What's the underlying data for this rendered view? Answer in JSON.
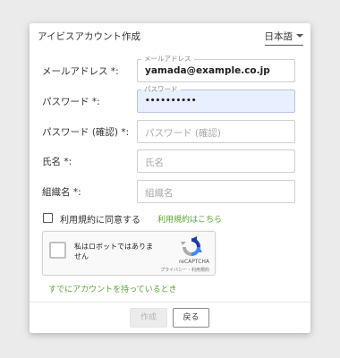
{
  "dialog": {
    "title": "アイビスアカウント作成",
    "language": "日本語"
  },
  "form": {
    "email": {
      "label": "メールアドレス *:",
      "legend": "メールアドレス",
      "value": "yamada@example.co.jp"
    },
    "password": {
      "label": "パスワード *:",
      "legend": "パスワード",
      "value": "••••••••••"
    },
    "password_confirm": {
      "label": "パスワード (確認) *:",
      "placeholder": "パスワード (確認)"
    },
    "name": {
      "label": "氏名 *:",
      "placeholder": "氏名"
    },
    "organization": {
      "label": "組織名 *:",
      "placeholder": "組織名"
    },
    "terms": {
      "label": "利用規約に同意する",
      "link": "利用規約はこちら"
    }
  },
  "captcha": {
    "text": "私はロボットではありません",
    "brand": "reCAPTCHA",
    "privacy": "プライバシー・利用規約"
  },
  "links": {
    "have_account": "すでにアカウントを持っているとき"
  },
  "buttons": {
    "create": "作成",
    "back": "戻る"
  },
  "colors": {
    "link_green": "#5aa532",
    "focused_field": "#e8efff"
  }
}
